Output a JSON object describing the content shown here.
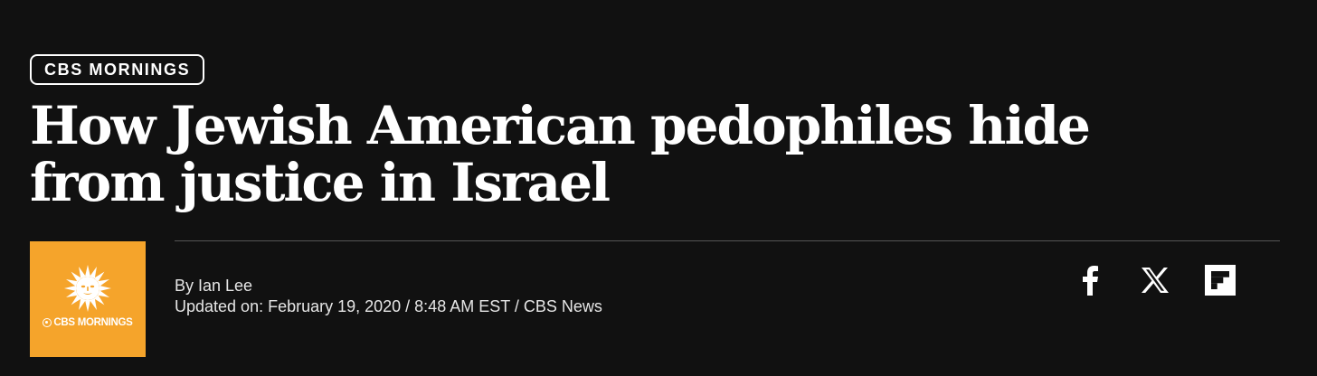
{
  "article": {
    "section_tag": "CBS MORNINGS",
    "headline": "How Jewish American pedophiles hide from justice in Israel",
    "byline": "By Ian Lee",
    "dateline": "Updated on: February 19, 2020 / 8:48 AM EST / CBS News"
  },
  "show_logo": {
    "wordmark": "CBS MORNINGS",
    "icon": "sun-icon",
    "background_color": "#F5A42B"
  },
  "share": {
    "buttons": [
      {
        "network": "Facebook",
        "icon": "facebook-icon"
      },
      {
        "network": "X",
        "icon": "x-icon"
      },
      {
        "network": "Flipboard",
        "icon": "flipboard-icon"
      }
    ]
  },
  "colors": {
    "background": "#111111",
    "text": "#ffffff"
  }
}
